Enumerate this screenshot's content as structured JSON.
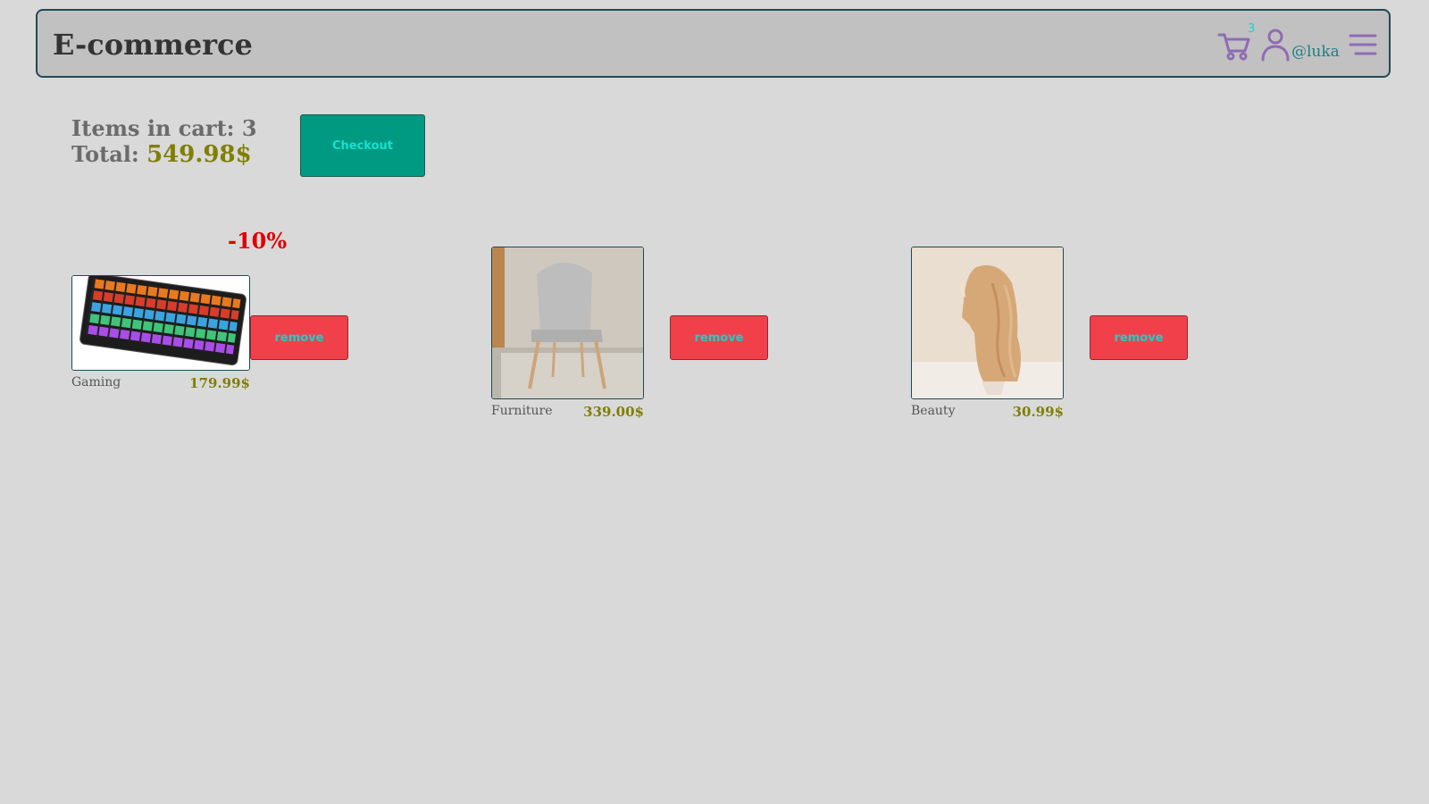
{
  "header": {
    "brand": "E-commerce",
    "cart_count": "3",
    "username": "@luka",
    "cart_icon": "cart-icon",
    "user_icon": "user-icon",
    "menu_icon": "hamburger-menu-icon"
  },
  "summary": {
    "items_label": "Items in cart: 3",
    "total_label": "Total:",
    "total_value": "549.98$"
  },
  "checkout_label": "Checkout",
  "items": [
    {
      "image": "keyboard-image",
      "category": "Gaming",
      "price": "179.99$",
      "discount": "-10%",
      "remove_label": "remove"
    },
    {
      "image": "chair-image",
      "category": "Furniture",
      "price": "339.00$",
      "remove_label": "remove"
    },
    {
      "image": "wig-image",
      "category": "Beauty",
      "price": "30.99$",
      "remove_label": "remove"
    }
  ],
  "colors": {
    "background": "#d9d9d9",
    "header_bg": "#c1c1c1",
    "header_border": "#1f4a55",
    "accent_icon": "#8f6bb5",
    "checkout": "#009982",
    "remove": "#f2404a",
    "price": "#7f7f00",
    "discount": "#e00000"
  }
}
